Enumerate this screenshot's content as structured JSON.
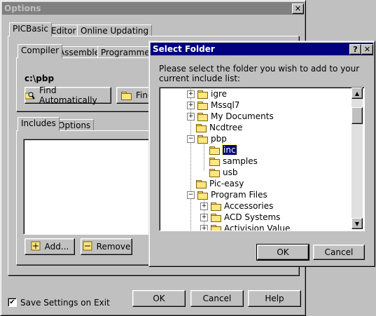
{
  "options_window": {
    "title": "Options",
    "close_label": "✕",
    "tabs": [
      "PICBasic",
      "Editor",
      "Online Updating"
    ],
    "subtabs": [
      "Compiler",
      "Assembler",
      "Programmer"
    ],
    "path": "c:\\pbp",
    "find_auto_label": "Find Automatically",
    "find_manual_label": "Find",
    "lower_tabs": [
      "Includes",
      "Options"
    ],
    "add_label": "Add...",
    "remove_label": "Remove",
    "save_settings_label": "Save Settings on Exit",
    "save_settings_checked": "✔",
    "ok_label": "OK",
    "cancel_label": "Cancel",
    "help_label": "Help"
  },
  "select_folder": {
    "title": "Select Folder",
    "help_label": "?",
    "close_label": "✕",
    "instruction": "Please select the folder you wish to add to your current include list:",
    "tree": [
      {
        "label": "igre",
        "expander": "+"
      },
      {
        "label": "Mssql7",
        "expander": "+"
      },
      {
        "label": "My Documents",
        "expander": "+"
      },
      {
        "label": "Ncdtree",
        "expander": ""
      },
      {
        "label": "pbp",
        "expander": "−"
      },
      {
        "label": "inc",
        "expander": ""
      },
      {
        "label": "samples",
        "expander": ""
      },
      {
        "label": "usb",
        "expander": ""
      },
      {
        "label": "Pic-easy",
        "expander": ""
      },
      {
        "label": "Program Files",
        "expander": "−"
      },
      {
        "label": "Accessories",
        "expander": "+"
      },
      {
        "label": "ACD Systems",
        "expander": "+"
      },
      {
        "label": "Activision Value",
        "expander": "+"
      }
    ],
    "scroll_up": "▲",
    "scroll_down": "▼",
    "ok_label": "OK",
    "cancel_label": "Cancel"
  }
}
